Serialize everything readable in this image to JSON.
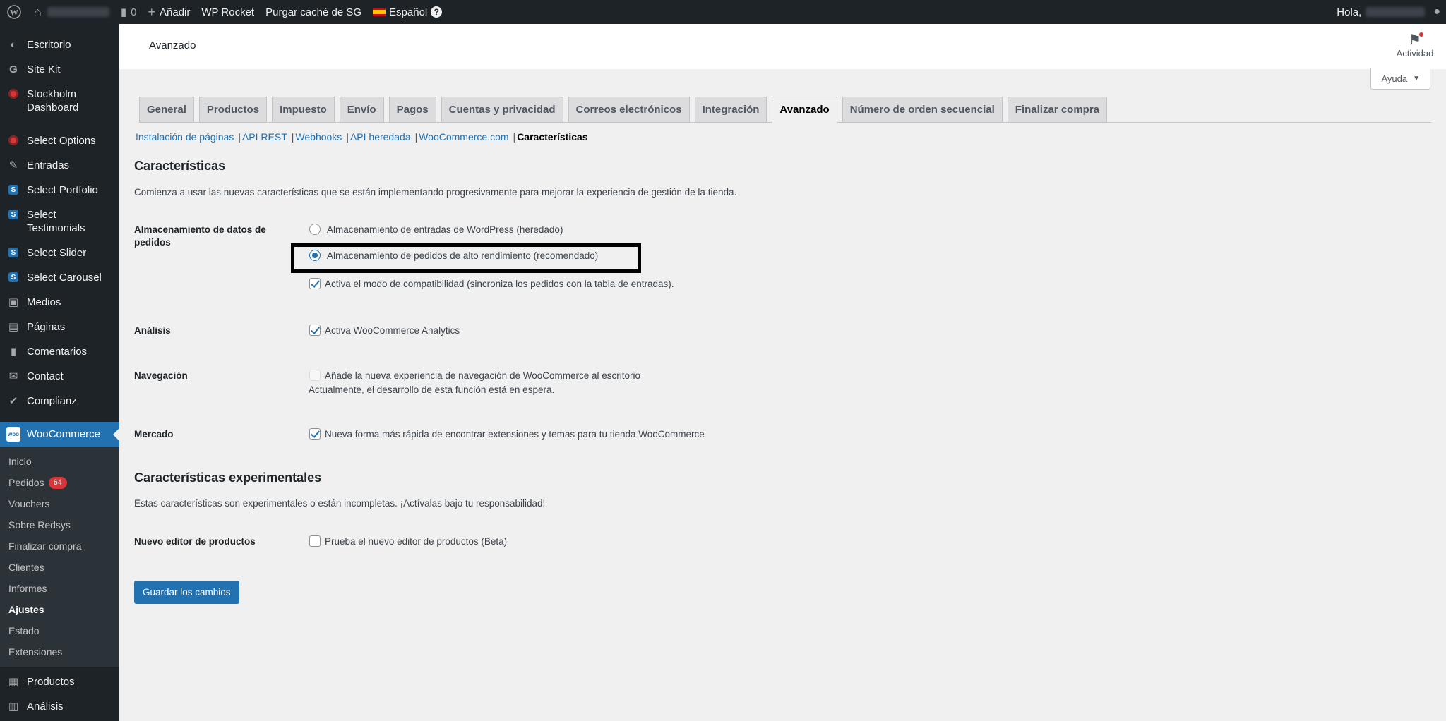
{
  "adminbar": {
    "comments_count": "0",
    "add_new": "Añadir",
    "wp_rocket": "WP Rocket",
    "purge_cache": "Purgar caché de SG",
    "language": "Español",
    "greeting": "Hola,"
  },
  "sidebar": {
    "items": [
      {
        "label": "Escritorio"
      },
      {
        "label": "Site Kit"
      },
      {
        "label": "Stockholm Dashboard"
      },
      {
        "label": "Select Options"
      },
      {
        "label": "Entradas"
      },
      {
        "label": "Select Portfolio"
      },
      {
        "label": "Select Testimonials"
      },
      {
        "label": "Select Slider"
      },
      {
        "label": "Select Carousel"
      },
      {
        "label": "Medios"
      },
      {
        "label": "Páginas"
      },
      {
        "label": "Comentarios"
      },
      {
        "label": "Contact"
      },
      {
        "label": "Complianz"
      },
      {
        "label": "WooCommerce"
      },
      {
        "label": "Productos"
      },
      {
        "label": "Análisis"
      }
    ],
    "submenu": [
      {
        "label": "Inicio"
      },
      {
        "label": "Pedidos",
        "badge": "64"
      },
      {
        "label": "Vouchers"
      },
      {
        "label": "Sobre Redsys"
      },
      {
        "label": "Finalizar compra"
      },
      {
        "label": "Clientes"
      },
      {
        "label": "Informes"
      },
      {
        "label": "Ajustes"
      },
      {
        "label": "Estado"
      },
      {
        "label": "Extensiones"
      }
    ]
  },
  "header": {
    "title": "Avanzado",
    "activity": "Actividad",
    "help": "Ayuda"
  },
  "tabs": [
    "General",
    "Productos",
    "Impuesto",
    "Envío",
    "Pagos",
    "Cuentas y privacidad",
    "Correos electrónicos",
    "Integración",
    "Avanzado",
    "Número de orden secuencial",
    "Finalizar compra"
  ],
  "subnav": [
    "Instalación de páginas",
    "API REST",
    "Webhooks",
    "API heredada",
    "WooCommerce.com",
    "Características"
  ],
  "features": {
    "heading": "Características",
    "description": "Comienza a usar las nuevas características que se están implementando progresivamente para mejorar la experiencia de gestión de la tienda.",
    "order_storage_label": "Almacenamiento de datos de pedidos",
    "order_storage_opt1": "Almacenamiento de entradas de WordPress (heredado)",
    "order_storage_opt2": "Almacenamiento de pedidos de alto rendimiento (recomendado)",
    "compat_mode": "Activa el modo de compatibilidad (sincroniza los pedidos con la tabla de entradas).",
    "analytics_label": "Análisis",
    "analytics_opt": "Activa WooCommerce Analytics",
    "nav_label": "Navegación",
    "nav_opt": "Añade la nueva experiencia de navegación de WooCommerce al escritorio",
    "nav_note": "Actualmente, el desarrollo de esta función está en espera.",
    "market_label": "Mercado",
    "market_opt": "Nueva forma más rápida de encontrar extensiones y temas para tu tienda WooCommerce"
  },
  "experimental": {
    "heading": "Características experimentales",
    "description": "Estas características son experimentales o están incompletas. ¡Actívalas bajo tu responsabilidad!",
    "editor_label": "Nuevo editor de productos",
    "editor_opt": "Prueba el nuevo editor de productos (Beta)"
  },
  "save_button": "Guardar los cambios",
  "colors": {
    "accent": "#2271b1",
    "admin_bar": "#1d2327",
    "badge": "#d63638"
  }
}
